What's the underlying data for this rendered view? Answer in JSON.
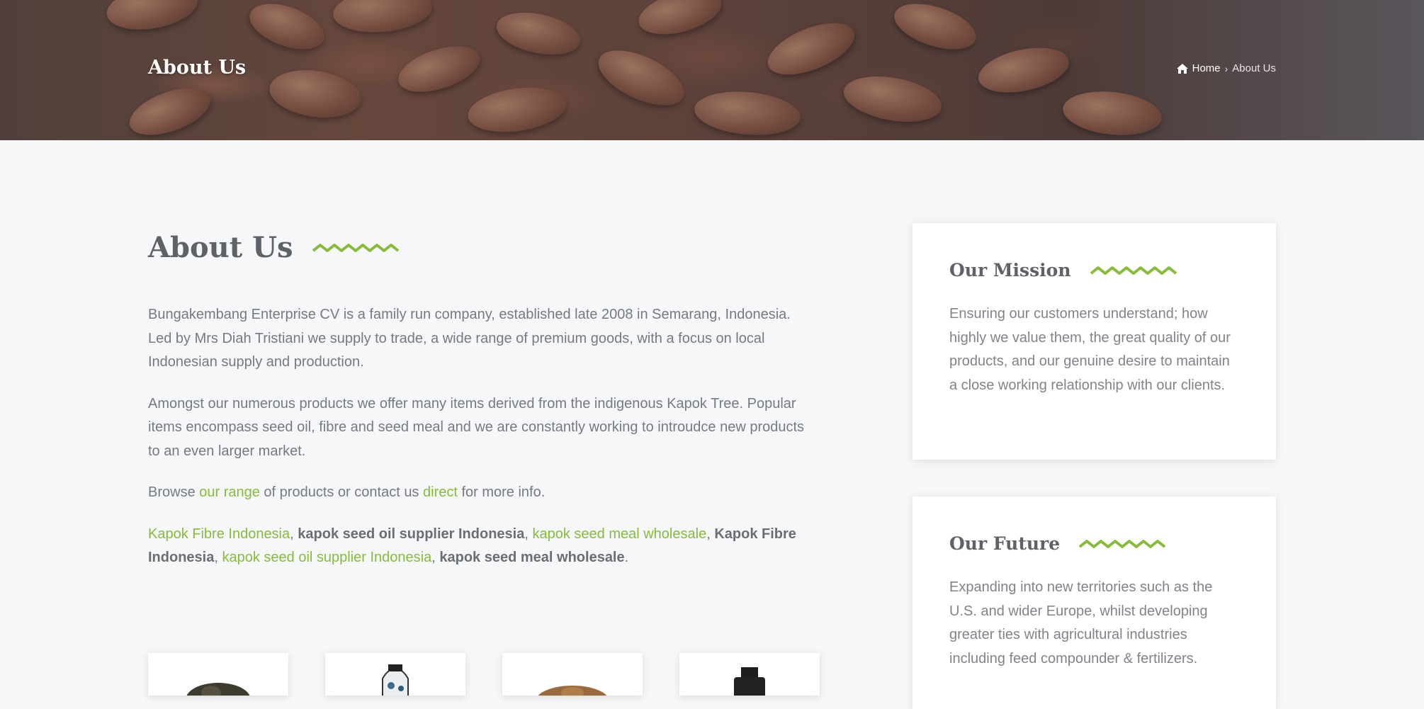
{
  "hero": {
    "title": "About Us",
    "breadcrumb": {
      "home_label": "Home",
      "current_label": "About Us",
      "home_icon": "home-icon",
      "separator_icon": "chevron-right-icon"
    }
  },
  "main": {
    "heading": "About Us",
    "paragraph1": "Bungakembang Enterprise CV is a family run company, established late 2008 in Semarang, Indonesia. Led by Mrs Diah Tristiani we supply to trade, a wide range of premium goods, with a focus on local Indonesian supply and production.",
    "paragraph2": "Amongst our numerous products we offer many items derived from the indigenous Kapok Tree. Popular items encompass seed oil, fibre and seed meal and we are constantly working to introudce new products to an even larger market.",
    "browse": {
      "prefix": "Browse ",
      "range_link": "our range",
      "middle": " of products or contact us ",
      "direct_link": "direct",
      "suffix": " for more info."
    },
    "tags": [
      {
        "text": "Kapok Fibre Indonesia",
        "link": true
      },
      {
        "text": "kapok seed oil supplier Indonesia",
        "link": false
      },
      {
        "text": "kapok seed meal wholesale",
        "link": true
      },
      {
        "text": "Kapok Fibre Indonesia",
        "link": false
      },
      {
        "text": "kapok seed oil supplier Indonesia",
        "link": true
      },
      {
        "text": "kapok seed meal wholesale",
        "link": false
      }
    ],
    "tag_separator": ", ",
    "tag_end": "."
  },
  "mission": {
    "title": "Our Mission",
    "text": "Ensuring our customers understand; how highly we value them, the great quality of our products, and our genuine desire to maintain a close working relationship with our clients."
  },
  "future": {
    "title": "Our Future",
    "text": "Expanding into new territories such as the U.S. and wider Europe, whilst developing greater ties with agricultural industries including feed compounder & fertilizers."
  },
  "colors": {
    "accent": "#86bc3a",
    "heading": "#5e6168",
    "body_text": "#767a80",
    "page_bg": "#f6f7f9"
  }
}
